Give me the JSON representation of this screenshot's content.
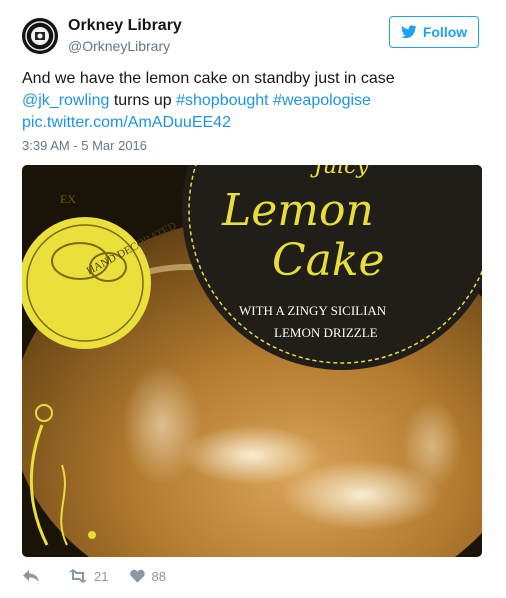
{
  "account": {
    "name": "Orkney Library",
    "handle": "@OrkneyLibrary"
  },
  "follow_button": {
    "label": "Follow",
    "icon": "twitter-bird-icon"
  },
  "tweet": {
    "line1": "And we have the lemon cake on standby just in case",
    "mention": "@jk_rowling",
    "middle": " turns up ",
    "hashtag1": "#shopbought",
    "hashtag2": "#weapologise",
    "link": "pic.twitter.com/AmADuuEE42",
    "timestamp": "3:39 AM - 5 Mar 2016"
  },
  "image": {
    "badge_line1": "EX",
    "badge_curve": "HAND DECORATED",
    "title_partial": "Juicy",
    "title_line1": "Lemon",
    "title_line2": "Cake",
    "subtitle_line1": "WITH A ZINGY SICILIAN",
    "subtitle_line2": "LEMON DRIZZLE"
  },
  "actions": {
    "reply_icon": "reply-icon",
    "retweet_icon": "retweet-icon",
    "retweet_count": "21",
    "like_icon": "heart-icon",
    "like_count": "88"
  },
  "colors": {
    "link": "#1b95e0",
    "follow": "#1da1f2",
    "muted": "#657786",
    "label_yellow": "#f2e34a"
  }
}
